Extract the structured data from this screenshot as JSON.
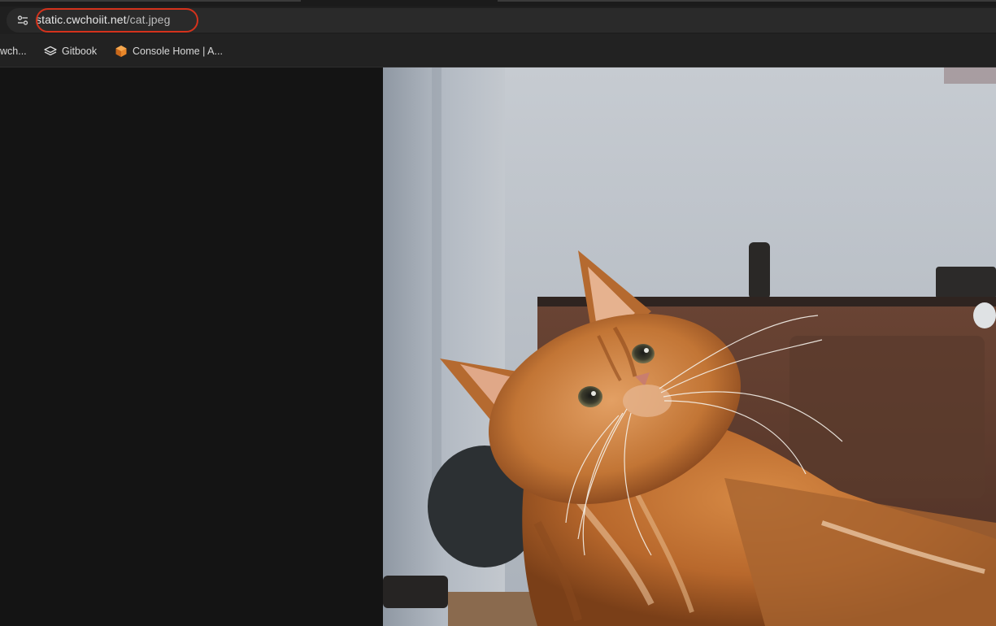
{
  "address_bar": {
    "host": "static.cwchoiit.net",
    "path": "/cat.jpeg",
    "site_info_icon": "tune-icon"
  },
  "bookmarks": [
    {
      "label": "wch...",
      "icon": "none"
    },
    {
      "label": "Gitbook",
      "icon": "gitbook-icon"
    },
    {
      "label": "Console Home | A...",
      "icon": "aws-cube-icon"
    }
  ],
  "viewer": {
    "image_alt": "orange cat photo",
    "image_subject": "orange long-haired cat looking up"
  },
  "colors": {
    "highlight": "#d4321c",
    "viewer_background": "#141414"
  }
}
